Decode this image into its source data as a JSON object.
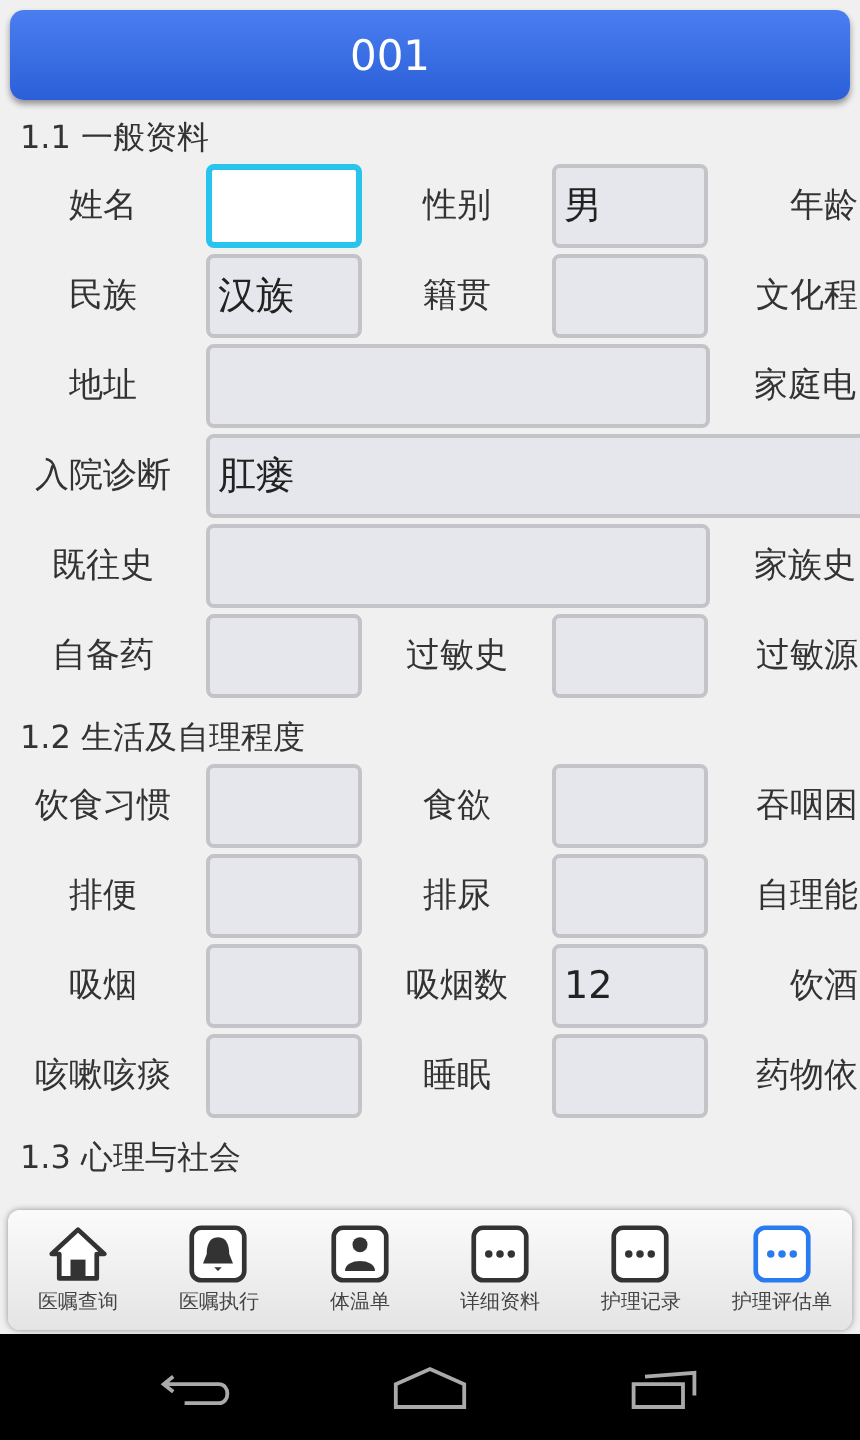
{
  "header": {
    "title": "001"
  },
  "sections": [
    {
      "title": "1.1 一般资料",
      "rows": [
        [
          {
            "label": "姓名",
            "kind": "short",
            "focused": true
          },
          {
            "label": "性别",
            "kind": "short",
            "value": "男",
            "focused": false
          },
          {
            "label": "年龄"
          }
        ],
        [
          {
            "label": "民族",
            "kind": "short",
            "value": "汉族",
            "focused": false
          },
          {
            "label": "籍贯",
            "kind": "short",
            "focused": false
          },
          {
            "label": "文化程"
          }
        ],
        [
          {
            "label": "地址",
            "kind": "wide",
            "focused": false
          },
          {
            "label": "家庭电"
          }
        ],
        [
          {
            "label": "入院诊断",
            "kind": "full",
            "value": "肛瘘",
            "focused": false
          }
        ],
        [
          {
            "label": "既往史",
            "kind": "wide",
            "focused": false
          },
          {
            "label": "家族史"
          }
        ],
        [
          {
            "label": "自备药",
            "kind": "short",
            "focused": false
          },
          {
            "label": "过敏史",
            "kind": "short",
            "focused": false
          },
          {
            "label": "过敏源"
          }
        ]
      ]
    },
    {
      "title": "1.2 生活及自理程度",
      "rows": [
        [
          {
            "label": "饮食习惯",
            "kind": "short",
            "focused": false
          },
          {
            "label": "食欲",
            "kind": "short",
            "focused": false
          },
          {
            "label": "吞咽困"
          }
        ],
        [
          {
            "label": "排便",
            "kind": "short",
            "focused": false
          },
          {
            "label": "排尿",
            "kind": "short",
            "focused": false
          },
          {
            "label": "自理能"
          }
        ],
        [
          {
            "label": "吸烟",
            "kind": "short",
            "focused": false
          },
          {
            "label": "吸烟数",
            "kind": "short",
            "value": "12",
            "focused": false
          },
          {
            "label": "饮酒"
          }
        ],
        [
          {
            "label": "咳嗽咳痰",
            "kind": "short",
            "focused": false
          },
          {
            "label": "睡眠",
            "kind": "short",
            "focused": false
          },
          {
            "label": "药物依"
          }
        ]
      ]
    },
    {
      "title": "1.3 心理与社会"
    }
  ],
  "tabs": [
    {
      "label": "医嘱查询",
      "kind": "home",
      "selected": false
    },
    {
      "label": "医嘱执行",
      "kind": "bell",
      "selected": false
    },
    {
      "label": "体温单",
      "kind": "person",
      "selected": false
    },
    {
      "label": "详细资料",
      "kind": "more",
      "selected": false
    },
    {
      "label": "护理记录",
      "kind": "more",
      "selected": false
    },
    {
      "label": "护理评估单",
      "kind": "more",
      "selected": true
    }
  ]
}
